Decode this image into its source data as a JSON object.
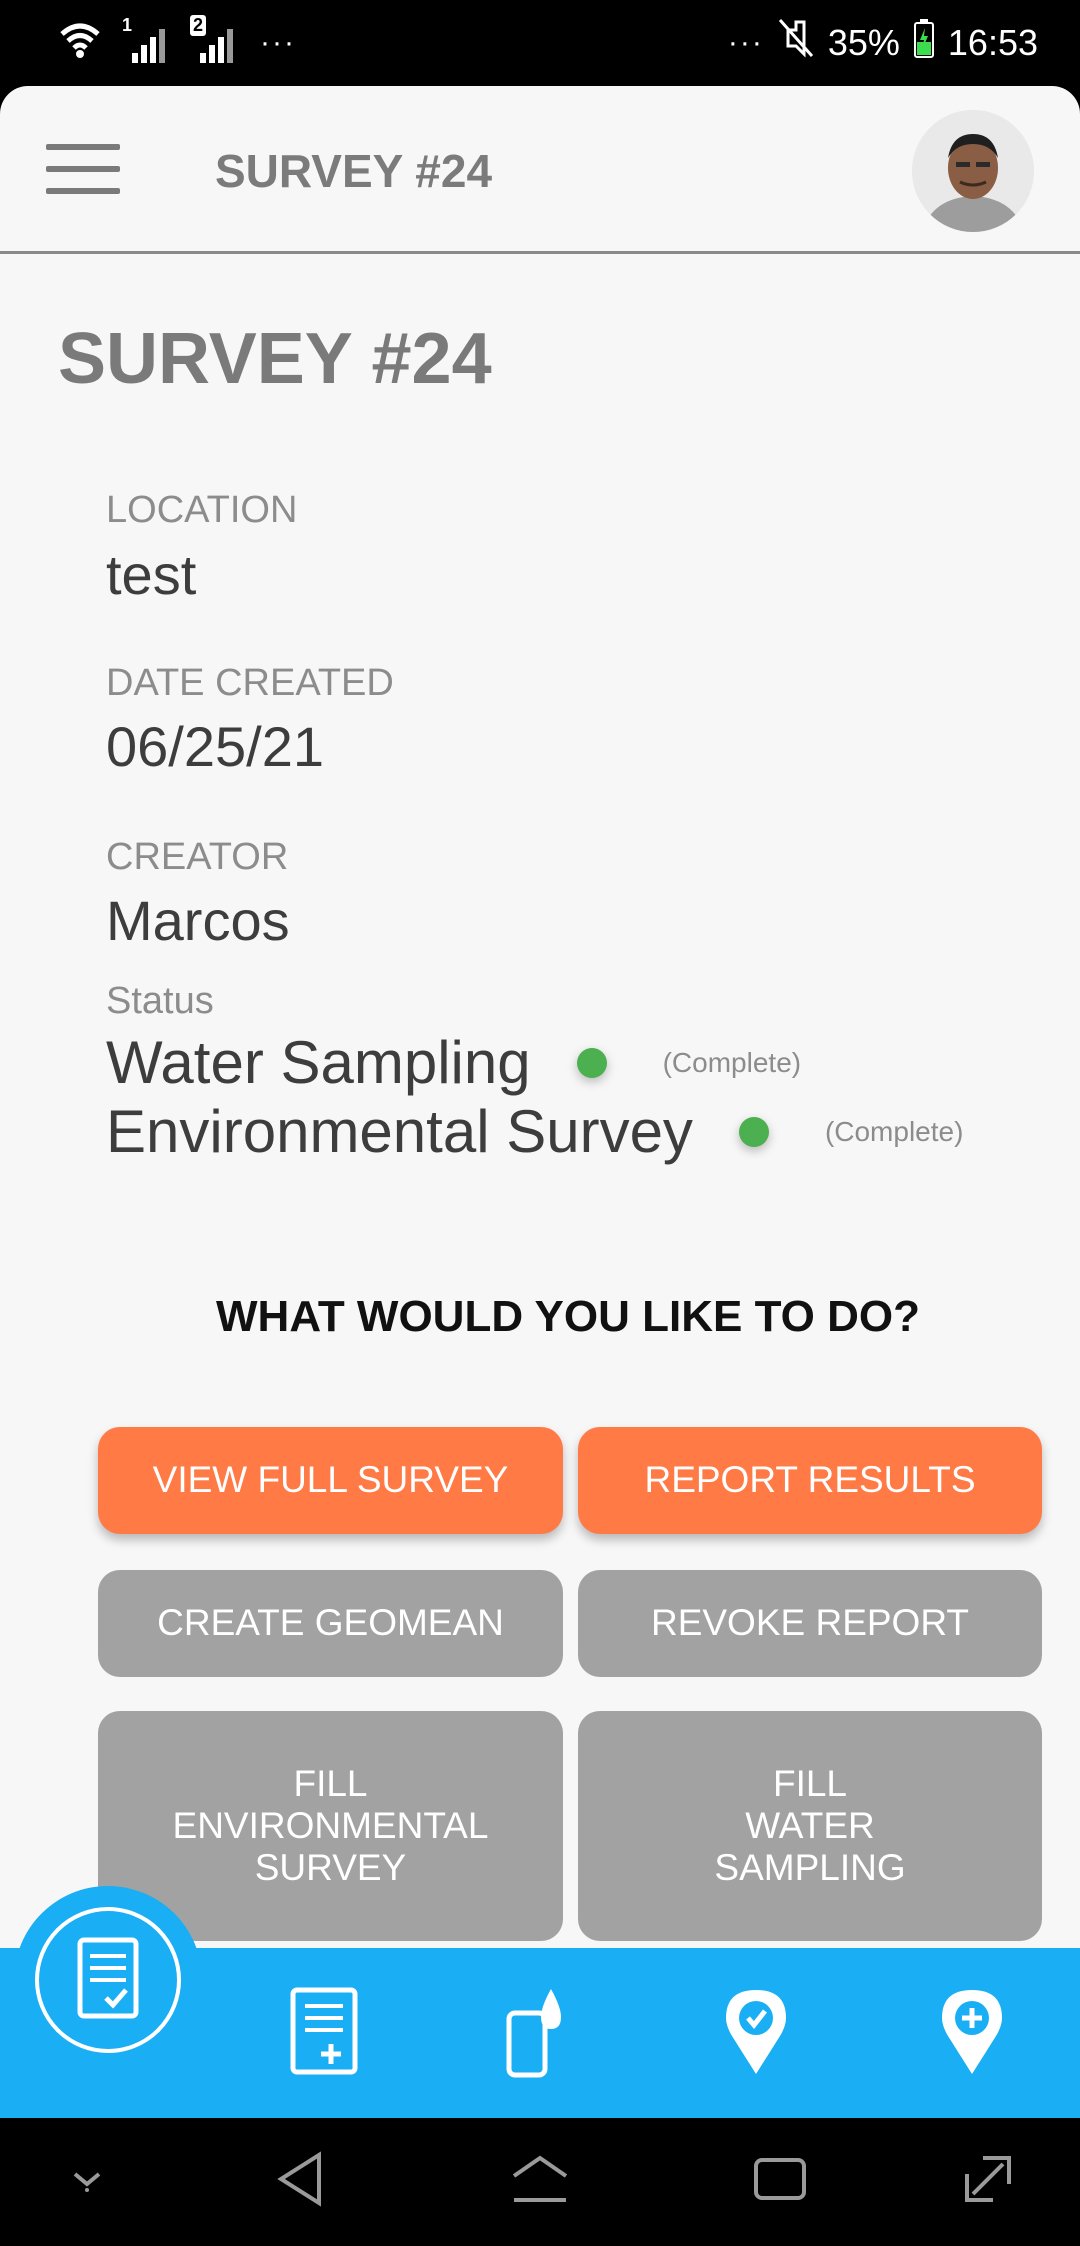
{
  "status_bar": {
    "sim1": "1",
    "sim2": "2",
    "left_dots": "···",
    "right_dots": "···",
    "battery": "35%",
    "time": "16:53"
  },
  "header": {
    "title": "SURVEY #24"
  },
  "page": {
    "title": "SURVEY #24",
    "location_label": "LOCATION",
    "location_value": "test",
    "date_label": "DATE CREATED",
    "date_value": "06/25/21",
    "creator_label": "CREATOR",
    "creator_value": "Marcos",
    "status_label": "Status",
    "status_items": [
      {
        "name": "Water Sampling",
        "state": "(Complete)"
      },
      {
        "name": "Environmental Survey",
        "state": "(Complete)"
      }
    ],
    "prompt": "WHAT WOULD YOU LIKE TO DO?"
  },
  "actions": {
    "view_full_survey": "VIEW FULL SURVEY",
    "report_results": "REPORT RESULTS",
    "create_geomean": "CREATE GEOMEAN",
    "revoke_report": "REVOKE REPORT",
    "fill_environmental": [
      "FILL",
      "ENVIRONMENTAL",
      "SURVEY"
    ],
    "fill_water": [
      "FILL",
      "WATER",
      "SAMPLING"
    ]
  },
  "colors": {
    "accent_orange": "#ff7a45",
    "nav_blue": "#1aaef4",
    "button_gray": "#a2a2a2",
    "status_green": "#4caf50"
  },
  "icons": {
    "bottom_nav": [
      "survey-list-icon",
      "new-survey-icon",
      "water-sample-icon",
      "location-check-icon",
      "location-add-icon"
    ]
  }
}
